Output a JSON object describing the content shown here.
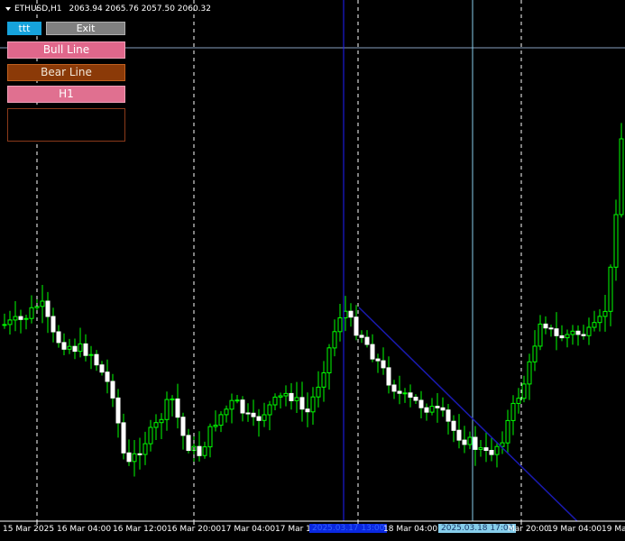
{
  "header": {
    "symbol": "ETHUSD,H1",
    "ohlc": "2063.94 2065.76 2057.50 2060.32"
  },
  "buttons": {
    "ttt": "ttt",
    "exit": "Exit",
    "bull_line": "Bull Line",
    "bear_line": "Bear Line",
    "h1": "H1"
  },
  "x_axis": {
    "labels": [
      "15 Mar 2025",
      "16 Mar 04:00",
      "16 Mar 12:00",
      "16 Mar 20:00",
      "17 Mar 04:00",
      "17 Mar 12",
      "18 Mar 04:00",
      "Mar 20:00",
      "19 Mar 04:00",
      "19 Mar"
    ],
    "highlight_left": "2025.03.17 13:00",
    "highlight_right": "2025.03.18 17:00"
  },
  "colors": {
    "background": "#000000",
    "bull_candle": "#00ff00",
    "bear_candle": "#ffffff",
    "grid": "#ffffff",
    "blue_line": "#1a1aff",
    "light_blue_line": "#87ceeb",
    "trend_line": "#1a1ab0"
  }
}
